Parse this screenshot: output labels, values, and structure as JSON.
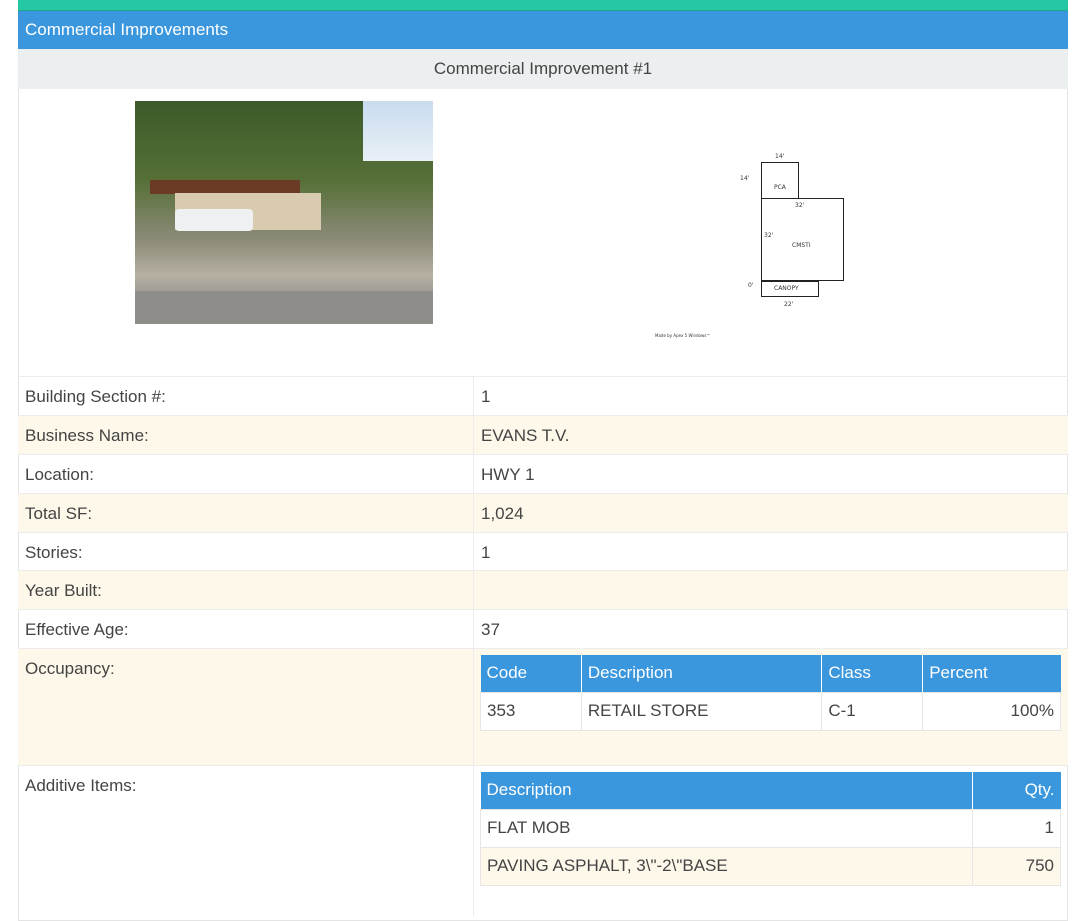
{
  "section_title": "Commercial Improvements",
  "improvement_title": "Commercial Improvement #1",
  "sketch": {
    "labels": [
      "14'",
      "14'",
      "PCA",
      "32'",
      "32'",
      "CMSTI",
      "0'",
      "CANOPY",
      "22'",
      "Made by Apex 5 Windows™"
    ]
  },
  "fields": [
    {
      "label": "Building Section #:",
      "value": "1"
    },
    {
      "label": "Business Name:",
      "value": "EVANS T.V."
    },
    {
      "label": "Location:",
      "value": "HWY 1"
    },
    {
      "label": "Total SF:",
      "value": "1,024"
    },
    {
      "label": "Stories:",
      "value": "1"
    },
    {
      "label": "Year Built:",
      "value": ""
    },
    {
      "label": "Effective Age:",
      "value": "37"
    },
    {
      "label": "Occupancy:",
      "value": ""
    },
    {
      "label": "Additive Items:",
      "value": ""
    }
  ],
  "occupancy": {
    "headers": [
      "Code",
      "Description",
      "Class",
      "Percent"
    ],
    "rows": [
      {
        "code": "353",
        "description": "RETAIL STORE",
        "class": "C-1",
        "percent": "100%"
      }
    ]
  },
  "additive_items": {
    "headers": [
      "Description",
      "Qty."
    ],
    "rows": [
      {
        "description": "FLAT MOB",
        "qty": "1"
      },
      {
        "description": "PAVING ASPHALT, 3\\\"-2\\\"BASE",
        "qty": "750"
      }
    ]
  }
}
